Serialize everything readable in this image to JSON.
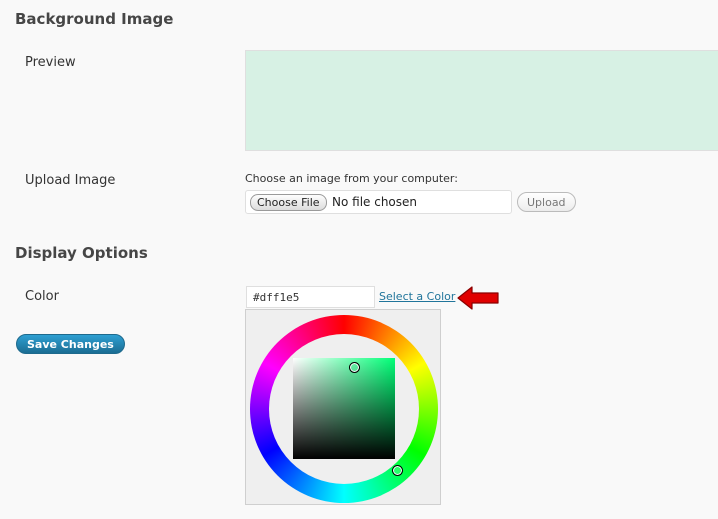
{
  "background_image": {
    "title": "Background Image",
    "preview_label": "Preview",
    "preview_color": "#d7f1e4",
    "upload_label": "Upload Image",
    "upload_hint": "Choose an image from your computer:",
    "choose_file_label": "Choose File",
    "no_file_text": "No file chosen",
    "upload_button_label": "Upload"
  },
  "display_options": {
    "title": "Display Options",
    "color_label": "Color",
    "color_value": "#dff1e5",
    "select_color_link": "Select a Color"
  },
  "save_changes_label": "Save Changes",
  "colors": {
    "accent_link": "#21759b",
    "save_button": "#21759b",
    "arrow": "#e00000"
  }
}
